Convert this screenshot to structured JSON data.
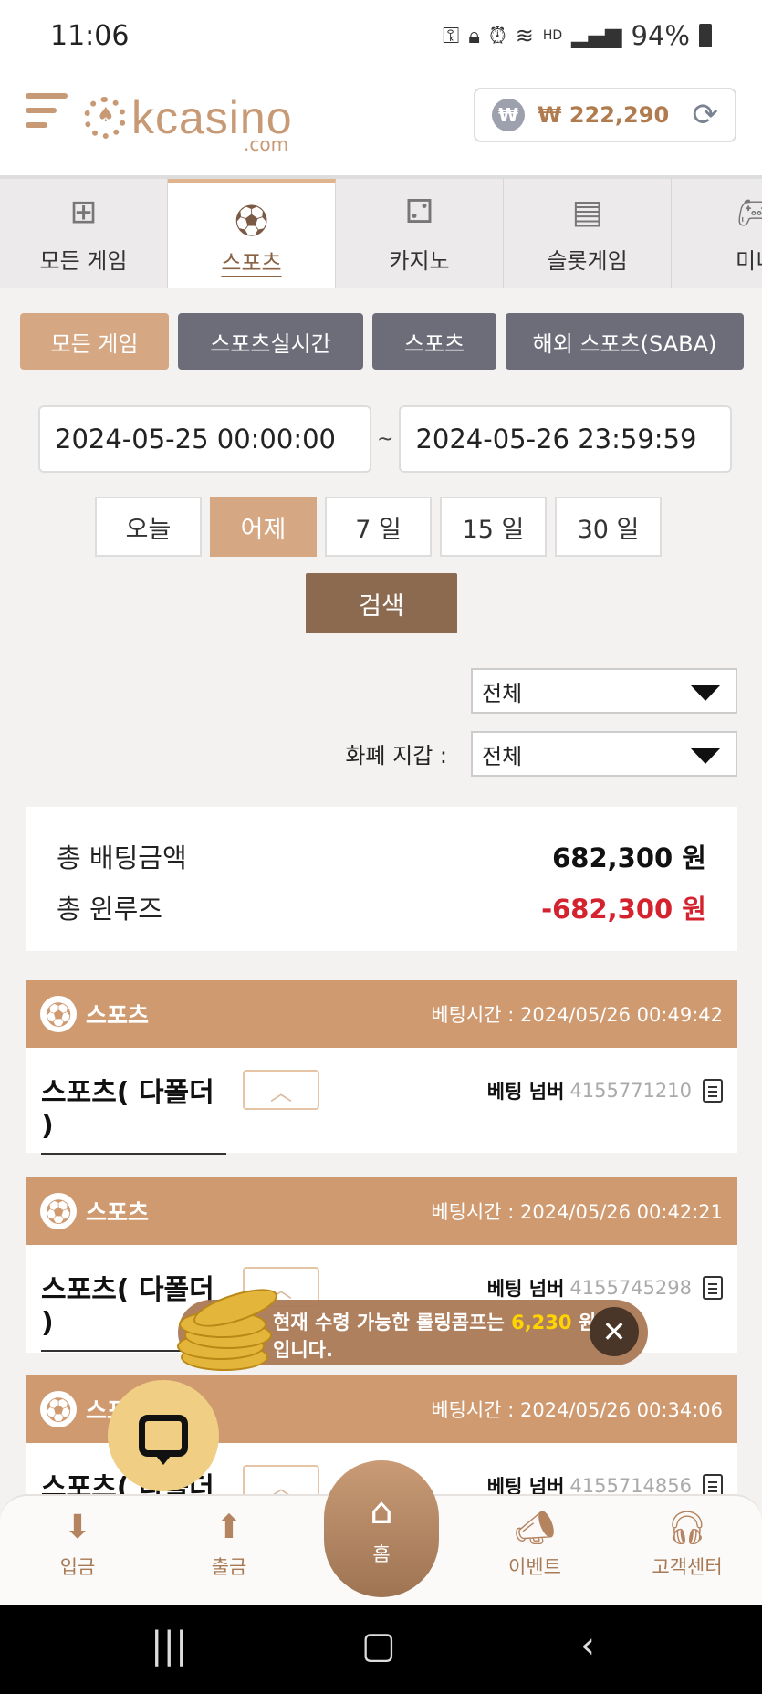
{
  "status_bar": {
    "time": "11:06",
    "hd": "HD",
    "battery": "94%"
  },
  "header": {
    "logo_text": "kcasino",
    "logo_sub": ".com",
    "balance": "₩ 222,290",
    "won_symbol": "₩"
  },
  "tabs": [
    {
      "label": "모든 게임",
      "icon": "grid-icon",
      "active": false
    },
    {
      "label": "스포츠",
      "icon": "soccer-ball-icon",
      "active": true
    },
    {
      "label": "카지노",
      "icon": "dice-icon",
      "active": false
    },
    {
      "label": "슬롯게임",
      "icon": "slot-machine-icon",
      "active": false
    },
    {
      "label": "미니",
      "icon": "gamepad-icon",
      "active": false
    }
  ],
  "filters": [
    {
      "label": "모든 게임",
      "active": true
    },
    {
      "label": "스포츠실시간",
      "active": false
    },
    {
      "label": "스포츠",
      "active": false
    },
    {
      "label": "해외 스포츠(SABA)",
      "active": false
    }
  ],
  "date_range": {
    "start": "2024-05-25 00:00:00",
    "separator": "~",
    "end": "2024-05-26 23:59:59"
  },
  "quick_ranges": [
    {
      "label": "오늘",
      "active": false
    },
    {
      "label": "어제",
      "active": true
    },
    {
      "label": "7 일",
      "active": false
    },
    {
      "label": "15 일",
      "active": false
    },
    {
      "label": "30 일",
      "active": false
    }
  ],
  "search_label": "검색",
  "select_filter": {
    "value": "전체"
  },
  "wallet_filter": {
    "label": "화폐 지갑 :",
    "value": "전체"
  },
  "summary": {
    "total_bet_label": "총 배팅금액",
    "total_bet_value": "682,300 원",
    "total_winloss_label": "총 윈루즈",
    "total_winloss_value": "-682,300 원"
  },
  "bets": [
    {
      "category": "스포츠",
      "time_label": "베팅시간 : 2024/05/26 00:49:42",
      "game": "스포츠( 다폴더 )",
      "bet_no_label": "베팅 넘버",
      "bet_no": "4155771210"
    },
    {
      "category": "스포츠",
      "time_label": "베팅시간 : 2024/05/26 00:42:21",
      "game": "스포츠( 다폴더 )",
      "bet_no_label": "베팅 넘버",
      "bet_no": "4155745298"
    },
    {
      "category": "스포츠",
      "time_label": "베팅시간 : 2024/05/26 00:34:06",
      "game": "스포츠( 다폴더 )",
      "bet_no_label": "베팅 넘버",
      "bet_no": "4155714856"
    }
  ],
  "toast": {
    "text_before": "현재 수령 가능한 롤링콤프는 ",
    "amount": "6,230",
    "text_after": " 원",
    "line2": "입니다."
  },
  "bottom_nav": {
    "deposit": "입금",
    "withdraw": "출금",
    "home": "홈",
    "event": "이벤트",
    "support": "고객센터"
  }
}
